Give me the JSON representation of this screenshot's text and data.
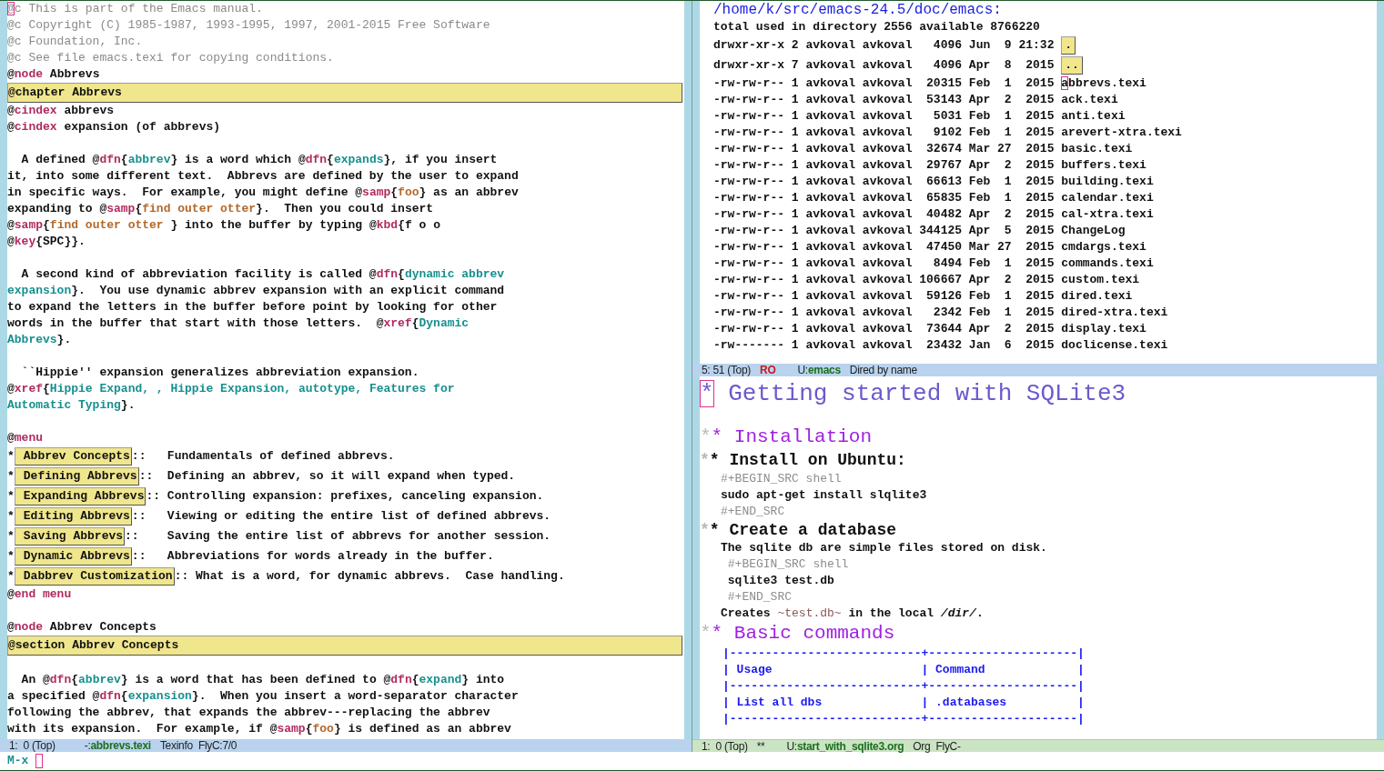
{
  "left_window": {
    "lines": [
      {
        "kind": "text",
        "segments": [
          {
            "kind": "cursor",
            "text": "@"
          },
          {
            "kind": "comment",
            "text": "c This is part of the Emacs manual."
          }
        ]
      },
      {
        "kind": "text",
        "segments": [
          {
            "kind": "comment",
            "text": "@c Copyright (C) 1985-1987, 1993-1995, 1997, 2001-2015 Free Software"
          }
        ]
      },
      {
        "kind": "text",
        "segments": [
          {
            "kind": "comment",
            "text": "@c Foundation, Inc."
          }
        ]
      },
      {
        "kind": "text",
        "segments": [
          {
            "kind": "comment",
            "text": "@c See file emacs.texi for copying conditions."
          }
        ]
      },
      {
        "kind": "text",
        "segments": [
          {
            "kind": "plain",
            "text": "@"
          },
          {
            "kind": "command",
            "text": "node"
          },
          {
            "kind": "plain",
            "text": " Abbrevs"
          }
        ]
      },
      {
        "kind": "heading",
        "segments": [
          {
            "kind": "plain",
            "text": "@chapter Abbrevs"
          }
        ]
      },
      {
        "kind": "text",
        "segments": [
          {
            "kind": "plain",
            "text": "@"
          },
          {
            "kind": "command",
            "text": "cindex"
          },
          {
            "kind": "plain",
            "text": " abbrevs"
          }
        ]
      },
      {
        "kind": "text",
        "segments": [
          {
            "kind": "plain",
            "text": "@"
          },
          {
            "kind": "command",
            "text": "cindex"
          },
          {
            "kind": "plain",
            "text": " expansion (of abbrevs)"
          }
        ]
      },
      {
        "kind": "blank"
      },
      {
        "kind": "text",
        "segments": [
          {
            "kind": "plain",
            "text": "  A defined @"
          },
          {
            "kind": "command",
            "text": "dfn"
          },
          {
            "kind": "plain",
            "text": "{"
          },
          {
            "kind": "term",
            "text": "abbrev"
          },
          {
            "kind": "plain",
            "text": "} is a word which @"
          },
          {
            "kind": "command",
            "text": "dfn"
          },
          {
            "kind": "plain",
            "text": "{"
          },
          {
            "kind": "term",
            "text": "expands"
          },
          {
            "kind": "plain",
            "text": "}, if you insert"
          }
        ]
      },
      {
        "kind": "text",
        "segments": [
          {
            "kind": "plain",
            "text": "it, into some different text.  Abbrevs are defined by the user to expand"
          }
        ]
      },
      {
        "kind": "text",
        "segments": [
          {
            "kind": "plain",
            "text": "in specific ways.  For example, you might define @"
          },
          {
            "kind": "command",
            "text": "samp"
          },
          {
            "kind": "plain",
            "text": "{"
          },
          {
            "kind": "sample",
            "text": "foo"
          },
          {
            "kind": "plain",
            "text": "} as an abbrev"
          }
        ]
      },
      {
        "kind": "text",
        "segments": [
          {
            "kind": "plain",
            "text": "expanding to @"
          },
          {
            "kind": "command",
            "text": "samp"
          },
          {
            "kind": "plain",
            "text": "{"
          },
          {
            "kind": "sample",
            "text": "find outer otter"
          },
          {
            "kind": "plain",
            "text": "}.  Then you could insert"
          }
        ]
      },
      {
        "kind": "text",
        "segments": [
          {
            "kind": "plain",
            "text": "@"
          },
          {
            "kind": "command",
            "text": "samp"
          },
          {
            "kind": "plain",
            "text": "{"
          },
          {
            "kind": "sample",
            "text": "find outer otter "
          },
          {
            "kind": "plain",
            "text": "} into the buffer by typing @"
          },
          {
            "kind": "command",
            "text": "kbd"
          },
          {
            "kind": "plain",
            "text": "{f o o"
          }
        ]
      },
      {
        "kind": "text",
        "segments": [
          {
            "kind": "plain",
            "text": "@"
          },
          {
            "kind": "command",
            "text": "key"
          },
          {
            "kind": "plain",
            "text": "{SPC}}."
          }
        ]
      },
      {
        "kind": "blank"
      },
      {
        "kind": "text",
        "segments": [
          {
            "kind": "plain",
            "text": "  A second kind of abbreviation facility is called @"
          },
          {
            "kind": "command",
            "text": "dfn"
          },
          {
            "kind": "plain",
            "text": "{"
          },
          {
            "kind": "term",
            "text": "dynamic abbrev"
          }
        ]
      },
      {
        "kind": "text",
        "segments": [
          {
            "kind": "term",
            "text": "expansion"
          },
          {
            "kind": "plain",
            "text": "}.  You use dynamic abbrev expansion with an explicit command"
          }
        ]
      },
      {
        "kind": "text",
        "segments": [
          {
            "kind": "plain",
            "text": "to expand the letters in the buffer before point by looking for other"
          }
        ]
      },
      {
        "kind": "text",
        "segments": [
          {
            "kind": "plain",
            "text": "words in the buffer that start with those letters.  @"
          },
          {
            "kind": "command",
            "text": "xref"
          },
          {
            "kind": "plain",
            "text": "{"
          },
          {
            "kind": "term",
            "text": "Dynamic"
          }
        ]
      },
      {
        "kind": "text",
        "segments": [
          {
            "kind": "term",
            "text": "Abbrevs"
          },
          {
            "kind": "plain",
            "text": "}."
          }
        ]
      },
      {
        "kind": "blank"
      },
      {
        "kind": "text",
        "segments": [
          {
            "kind": "plain",
            "text": "  ``Hippie'' expansion generalizes abbreviation expansion."
          }
        ]
      },
      {
        "kind": "text",
        "segments": [
          {
            "kind": "plain",
            "text": "@"
          },
          {
            "kind": "command",
            "text": "xref"
          },
          {
            "kind": "plain",
            "text": "{"
          },
          {
            "kind": "term",
            "text": "Hippie Expand, , Hippie Expansion, autotype, Features for"
          }
        ]
      },
      {
        "kind": "text",
        "segments": [
          {
            "kind": "term",
            "text": "Automatic Typing"
          },
          {
            "kind": "plain",
            "text": "}."
          }
        ]
      },
      {
        "kind": "blank"
      },
      {
        "kind": "text",
        "segments": [
          {
            "kind": "plain",
            "text": "@"
          },
          {
            "kind": "command",
            "text": "menu"
          }
        ]
      },
      {
        "kind": "menu",
        "bullet": "*",
        "entry": "Abbrev Concepts",
        "description": "::   Fundamentals of defined abbrevs."
      },
      {
        "kind": "menu",
        "bullet": "*",
        "entry": "Defining Abbrevs",
        "description": "::  Defining an abbrev, so it will expand when typed."
      },
      {
        "kind": "menu",
        "bullet": "*",
        "entry": "Expanding Abbrevs",
        "description": ":: Controlling expansion: prefixes, canceling expansion."
      },
      {
        "kind": "menu",
        "bullet": "*",
        "entry": "Editing Abbrevs",
        "description": "::   Viewing or editing the entire list of defined abbrevs."
      },
      {
        "kind": "menu",
        "bullet": "*",
        "entry": "Saving Abbrevs",
        "description": "::    Saving the entire list of abbrevs for another session."
      },
      {
        "kind": "menu",
        "bullet": "*",
        "entry": "Dynamic Abbrevs",
        "description": "::   Abbreviations for words already in the buffer."
      },
      {
        "kind": "menu",
        "bullet": "*",
        "entry": "Dabbrev Customization",
        "description": ":: What is a word, for dynamic abbrevs.  Case handling."
      },
      {
        "kind": "text",
        "segments": [
          {
            "kind": "plain",
            "text": "@"
          },
          {
            "kind": "command",
            "text": "end menu"
          }
        ]
      },
      {
        "kind": "blank"
      },
      {
        "kind": "text",
        "segments": [
          {
            "kind": "plain",
            "text": "@"
          },
          {
            "kind": "command",
            "text": "node"
          },
          {
            "kind": "plain",
            "text": " Abbrev Concepts"
          }
        ]
      },
      {
        "kind": "heading",
        "segments": [
          {
            "kind": "plain",
            "text": "@section Abbrev Concepts"
          }
        ]
      },
      {
        "kind": "blank"
      },
      {
        "kind": "text",
        "segments": [
          {
            "kind": "plain",
            "text": "  An @"
          },
          {
            "kind": "command",
            "text": "dfn"
          },
          {
            "kind": "plain",
            "text": "{"
          },
          {
            "kind": "term",
            "text": "abbrev"
          },
          {
            "kind": "plain",
            "text": "} is a word that has been defined to @"
          },
          {
            "kind": "command",
            "text": "dfn"
          },
          {
            "kind": "plain",
            "text": "{"
          },
          {
            "kind": "term",
            "text": "expand"
          },
          {
            "kind": "plain",
            "text": "} into"
          }
        ]
      },
      {
        "kind": "text",
        "segments": [
          {
            "kind": "plain",
            "text": "a specified @"
          },
          {
            "kind": "command",
            "text": "dfn"
          },
          {
            "kind": "plain",
            "text": "{"
          },
          {
            "kind": "term",
            "text": "expansion"
          },
          {
            "kind": "plain",
            "text": "}.  When you insert a word-separator character"
          }
        ]
      },
      {
        "kind": "text",
        "segments": [
          {
            "kind": "plain",
            "text": "following the abbrev, that expands the abbrev---replacing the abbrev"
          }
        ]
      },
      {
        "kind": "text",
        "segments": [
          {
            "kind": "plain",
            "text": "with its expansion.  For example, if @"
          },
          {
            "kind": "command",
            "text": "samp"
          },
          {
            "kind": "plain",
            "text": "{"
          },
          {
            "kind": "sample",
            "text": "foo"
          },
          {
            "kind": "plain",
            "text": "} is defined as an abbrev"
          }
        ]
      }
    ],
    "mode_line": {
      "position": "1:  0 (Top)",
      "state": "-:",
      "buffer": "abbrevs.texi",
      "modes": "Texinfo  FlyC:7/0",
      "active": false
    }
  },
  "dired_window": {
    "header": "/home/k/src/emacs-24.5/doc/emacs:",
    "summary": "total used in directory 2556 available 8766220",
    "rows": [
      {
        "kind": "dir",
        "attributes": "drwxr-xr-x 2 avkoval avkoval   4096 Jun  9 21:32",
        "name": ".",
        "cursor": false
      },
      {
        "kind": "dir",
        "attributes": "drwxr-xr-x 7 avkoval avkoval   4096 Apr  8  2015",
        "name": "..",
        "cursor": false
      },
      {
        "kind": "file",
        "attributes": "-rw-rw-r-- 1 avkoval avkoval  20315 Feb  1  2015",
        "name": "abbrevs.texi",
        "cursor": true
      },
      {
        "kind": "file",
        "attributes": "-rw-rw-r-- 1 avkoval avkoval  53143 Apr  2  2015",
        "name": "ack.texi",
        "cursor": false
      },
      {
        "kind": "file",
        "attributes": "-rw-rw-r-- 1 avkoval avkoval   5031 Feb  1  2015",
        "name": "anti.texi",
        "cursor": false
      },
      {
        "kind": "file",
        "attributes": "-rw-rw-r-- 1 avkoval avkoval   9102 Feb  1  2015",
        "name": "arevert-xtra.texi",
        "cursor": false
      },
      {
        "kind": "file",
        "attributes": "-rw-rw-r-- 1 avkoval avkoval  32674 Mar 27  2015",
        "name": "basic.texi",
        "cursor": false
      },
      {
        "kind": "file",
        "attributes": "-rw-rw-r-- 1 avkoval avkoval  29767 Apr  2  2015",
        "name": "buffers.texi",
        "cursor": false
      },
      {
        "kind": "file",
        "attributes": "-rw-rw-r-- 1 avkoval avkoval  66613 Feb  1  2015",
        "name": "building.texi",
        "cursor": false
      },
      {
        "kind": "file",
        "attributes": "-rw-rw-r-- 1 avkoval avkoval  65835 Feb  1  2015",
        "name": "calendar.texi",
        "cursor": false
      },
      {
        "kind": "file",
        "attributes": "-rw-rw-r-- 1 avkoval avkoval  40482 Apr  2  2015",
        "name": "cal-xtra.texi",
        "cursor": false
      },
      {
        "kind": "file",
        "attributes": "-rw-rw-r-- 1 avkoval avkoval 344125 Apr  5  2015",
        "name": "ChangeLog",
        "cursor": false
      },
      {
        "kind": "file",
        "attributes": "-rw-rw-r-- 1 avkoval avkoval  47450 Mar 27  2015",
        "name": "cmdargs.texi",
        "cursor": false
      },
      {
        "kind": "file",
        "attributes": "-rw-rw-r-- 1 avkoval avkoval   8494 Feb  1  2015",
        "name": "commands.texi",
        "cursor": false
      },
      {
        "kind": "file",
        "attributes": "-rw-rw-r-- 1 avkoval avkoval 106667 Apr  2  2015",
        "name": "custom.texi",
        "cursor": false
      },
      {
        "kind": "file",
        "attributes": "-rw-rw-r-- 1 avkoval avkoval  59126 Feb  1  2015",
        "name": "dired.texi",
        "cursor": false
      },
      {
        "kind": "file",
        "attributes": "-rw-rw-r-- 1 avkoval avkoval   2342 Feb  1  2015",
        "name": "dired-xtra.texi",
        "cursor": false
      },
      {
        "kind": "file",
        "attributes": "-rw-rw-r-- 1 avkoval avkoval  73644 Apr  2  2015",
        "name": "display.texi",
        "cursor": false
      },
      {
        "kind": "file",
        "attributes": "-rw------- 1 avkoval avkoval  23432 Jan  6  2015",
        "name": "doclicense.texi",
        "cursor": false
      }
    ],
    "mode_line": {
      "position": "5: 51 (Top)",
      "flag": {
        "kind": "read-only",
        "text": "RO"
      },
      "state": "U:",
      "buffer": "emacs",
      "modes": "Dired by name",
      "active": false
    }
  },
  "org_window": {
    "blocks": [
      {
        "kind": "title",
        "stars": "*",
        "text": "Getting started with SQLite3",
        "cursor": true
      },
      {
        "kind": "blank"
      },
      {
        "kind": "heading1",
        "hidden_stars": "*",
        "stars": "*",
        "text": "Installation"
      },
      {
        "kind": "heading2",
        "hidden_stars": "*",
        "stars": "*",
        "text": "Install on Ubuntu:"
      },
      {
        "kind": "keyword",
        "text": "#+BEGIN_SRC shell"
      },
      {
        "kind": "code",
        "text": "sudo apt-get install slqlite3"
      },
      {
        "kind": "keyword",
        "text": "#+END_SRC"
      },
      {
        "kind": "heading2",
        "hidden_stars": "*",
        "stars": "*",
        "text": "Create a database"
      },
      {
        "kind": "text",
        "segments": [
          {
            "kind": "plain",
            "text": "The sqlite db are simple files stored on disk."
          }
        ]
      },
      {
        "kind": "keyword",
        "text": " #+BEGIN_SRC shell"
      },
      {
        "kind": "code",
        "text": " sqlite3 test.db"
      },
      {
        "kind": "keyword",
        "text": " #+END_SRC"
      },
      {
        "kind": "text",
        "segments": [
          {
            "kind": "plain",
            "text": "Creates "
          },
          {
            "kind": "verbatim",
            "text": "~test.db~"
          },
          {
            "kind": "plain",
            "text": " in the local "
          },
          {
            "kind": "italic",
            "text": "/dir/"
          },
          {
            "kind": "plain",
            "text": "."
          }
        ]
      },
      {
        "kind": "heading1",
        "hidden_stars": "*",
        "stars": "*",
        "text": "Basic commands"
      },
      {
        "kind": "table_rule",
        "text": "|---------------------------+---------------------|"
      },
      {
        "kind": "table_row",
        "text": "| Usage                     | Command             |"
      },
      {
        "kind": "table_rule",
        "text": "|---------------------------+---------------------|"
      },
      {
        "kind": "table_row",
        "text": "| List all dbs              | .databases          |"
      },
      {
        "kind": "table_rule",
        "text": "|---------------------------+---------------------|"
      }
    ],
    "mode_line": {
      "position": "1:  0 (Top)",
      "flag": {
        "kind": "modified",
        "text": "**"
      },
      "state": "U:",
      "buffer": "start_with_sqlite3.org",
      "modes": "Org  FlyC-",
      "active": true
    }
  },
  "minibuffer": {
    "prompt": "M-x",
    "cursor": true
  }
}
